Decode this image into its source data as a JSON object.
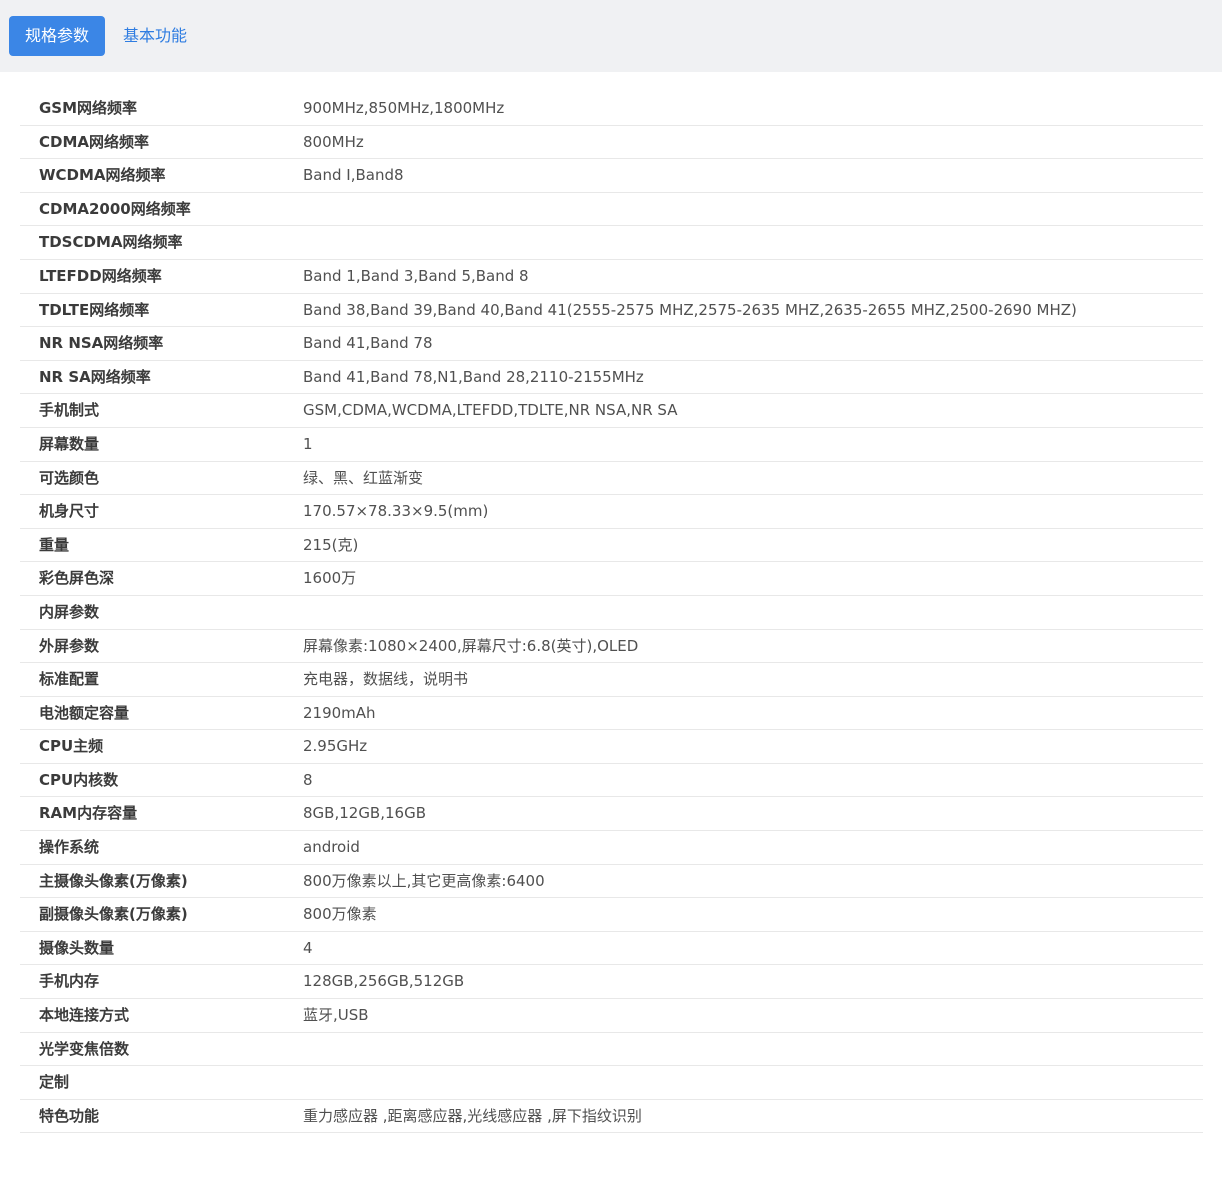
{
  "tabs": [
    {
      "label": "规格参数",
      "active": true
    },
    {
      "label": "基本功能",
      "active": false
    }
  ],
  "colors": {
    "accent": "#3b86e6",
    "link": "#2f7de1",
    "header_bg": "#f0f1f3"
  },
  "specs": [
    {
      "label": "GSM网络频率",
      "value": "900MHz,850MHz,1800MHz"
    },
    {
      "label": "CDMA网络频率",
      "value": "800MHz"
    },
    {
      "label": "WCDMA网络频率",
      "value": "Band I,Band8"
    },
    {
      "label": "CDMA2000网络频率",
      "value": ""
    },
    {
      "label": "TDSCDMA网络频率",
      "value": ""
    },
    {
      "label": "LTEFDD网络频率",
      "value": "Band 1,Band 3,Band 5,Band 8"
    },
    {
      "label": "TDLTE网络频率",
      "value": "Band 38,Band 39,Band 40,Band 41(2555-2575 MHZ,2575-2635 MHZ,2635-2655 MHZ,2500-2690 MHZ)"
    },
    {
      "label": "NR NSA网络频率",
      "value": "Band 41,Band 78"
    },
    {
      "label": "NR SA网络频率",
      "value": "Band 41,Band 78,N1,Band 28,2110-2155MHz"
    },
    {
      "label": "手机制式",
      "value": "GSM,CDMA,WCDMA,LTEFDD,TDLTE,NR NSA,NR SA"
    },
    {
      "label": "屏幕数量",
      "value": "1"
    },
    {
      "label": "可选颜色",
      "value": "绿、黑、红蓝渐变"
    },
    {
      "label": "机身尺寸",
      "value": "170.57×78.33×9.5(mm)"
    },
    {
      "label": "重量",
      "value": "215(克)"
    },
    {
      "label": "彩色屏色深",
      "value": "1600万"
    },
    {
      "label": "内屏参数",
      "value": ""
    },
    {
      "label": "外屏参数",
      "value": "屏幕像素:1080×2400,屏幕尺寸:6.8(英寸),OLED"
    },
    {
      "label": "标准配置",
      "value": "充电器，数据线，说明书"
    },
    {
      "label": "电池额定容量",
      "value": "2190mAh"
    },
    {
      "label": "CPU主频",
      "value": "2.95GHz"
    },
    {
      "label": "CPU内核数",
      "value": "8"
    },
    {
      "label": "RAM内存容量",
      "value": "8GB,12GB,16GB"
    },
    {
      "label": "操作系统",
      "value": "android"
    },
    {
      "label": "主摄像头像素(万像素)",
      "value": "800万像素以上,其它更高像素:6400"
    },
    {
      "label": "副摄像头像素(万像素)",
      "value": "800万像素"
    },
    {
      "label": "摄像头数量",
      "value": "4"
    },
    {
      "label": "手机内存",
      "value": "128GB,256GB,512GB"
    },
    {
      "label": "本地连接方式",
      "value": "蓝牙,USB"
    },
    {
      "label": "光学变焦倍数",
      "value": ""
    },
    {
      "label": "定制",
      "value": ""
    },
    {
      "label": "特色功能",
      "value": "重力感应器 ,距离感应器,光线感应器 ,屏下指纹识别"
    }
  ]
}
